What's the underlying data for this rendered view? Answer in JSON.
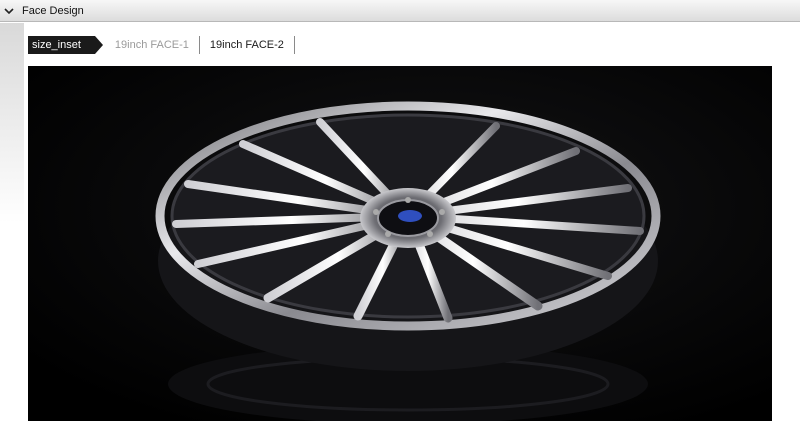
{
  "header": {
    "title": "Face Design",
    "collapse_icon": "chevron-down-icon"
  },
  "tabs": {
    "active_label": "size_inset",
    "items": [
      {
        "label": "19inch FACE-1",
        "style": "dim"
      },
      {
        "label": "19inch FACE-2",
        "style": "normal"
      }
    ]
  },
  "photo": {
    "subject": "wheel-image",
    "background_color": "#000000"
  }
}
